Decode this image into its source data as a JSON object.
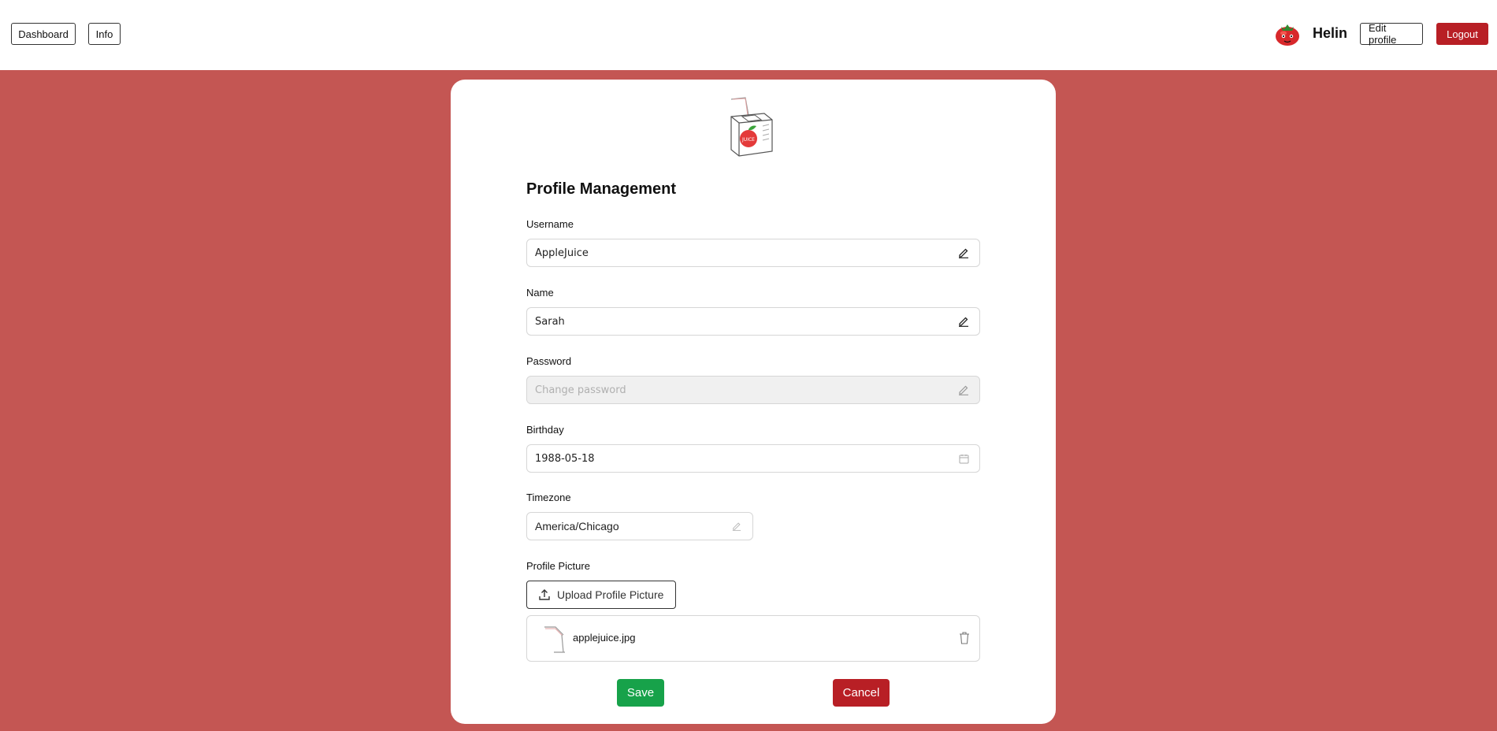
{
  "header": {
    "nav": {
      "dashboard_label": "Dashboard",
      "info_label": "Info"
    },
    "user": {
      "name": "Helin",
      "avatar_icon": "tomato-avatar-icon"
    },
    "edit_profile_label": "Edit profile",
    "logout_label": "Logout"
  },
  "main": {
    "logo_icon": "apple-juice-box-logo",
    "logo_text": "JUICE",
    "title": "Profile Management",
    "fields": {
      "username": {
        "label": "Username",
        "value": "AppleJuice",
        "icon": "pencil-icon"
      },
      "name": {
        "label": "Name",
        "value": "Sarah",
        "icon": "pencil-icon"
      },
      "password": {
        "label": "Password",
        "placeholder": "Change password",
        "icon": "pencil-icon"
      },
      "birthday": {
        "label": "Birthday",
        "value": "1988-05-18",
        "icon": "calendar-icon"
      },
      "timezone": {
        "label": "Timezone",
        "value": "America/Chicago",
        "icon": "pencil-icon"
      }
    },
    "profile_picture": {
      "label": "Profile Picture",
      "upload_label": "Upload Profile Picture",
      "file_name": "applejuice.jpg"
    },
    "actions": {
      "save_label": "Save",
      "cancel_label": "Cancel"
    }
  },
  "colors": {
    "background": "#c45653",
    "save": "#17a24a",
    "danger": "#b81f25"
  }
}
